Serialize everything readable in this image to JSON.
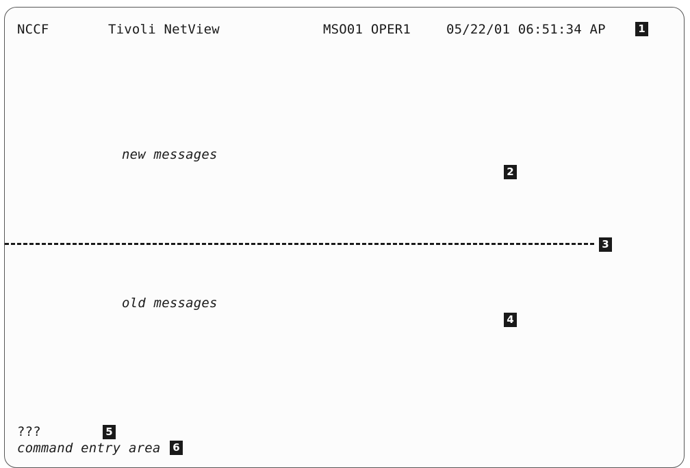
{
  "header": {
    "app": "NCCF",
    "product": "Tivoli NetView",
    "domain_operator": "MSO01 OPER1",
    "datetime": "05/22/01 06:51:34 AP"
  },
  "areas": {
    "new_messages": "new messages",
    "old_messages": "old messages",
    "response_indicator": "???",
    "command_entry": "command entry area"
  },
  "callouts": [
    "1",
    "2",
    "3",
    "4",
    "5",
    "6"
  ]
}
